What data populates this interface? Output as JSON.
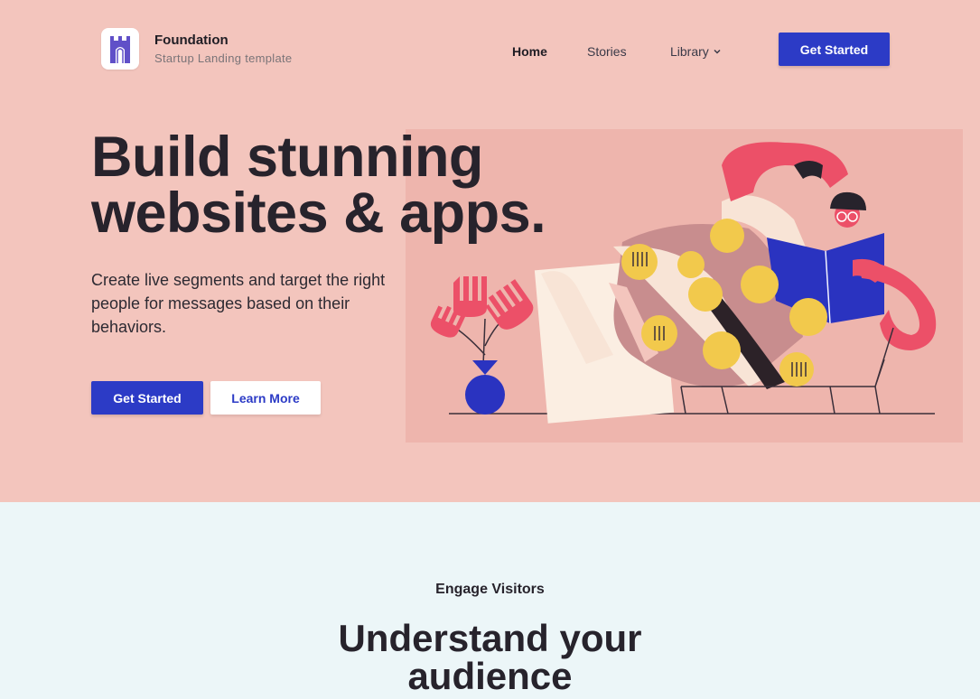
{
  "header": {
    "brand_name": "Foundation",
    "brand_tagline": "Startup Landing template",
    "logo_icon": "castle-tower-icon",
    "nav": {
      "home": "Home",
      "stories": "Stories",
      "library": "Library"
    },
    "cta_label": "Get Started"
  },
  "hero": {
    "headline_line1": "Build stunning",
    "headline_line2": "websites & apps.",
    "description": "Create live segments and target the right people for messages based on their behaviors.",
    "primary_button": "Get Started",
    "secondary_button": "Learn More",
    "illustration_icon": "person-reading-book-illustration"
  },
  "section": {
    "eyebrow": "Engage Visitors",
    "title_line1": "Understand your",
    "title_line2": "audience"
  },
  "colors": {
    "hero_bg": "#f3c5bd",
    "illustration_bg": "#eeb5ad",
    "accent_blue": "#2c3bc6",
    "section_bg": "#ecf6f8",
    "text_dark": "#27232c"
  }
}
